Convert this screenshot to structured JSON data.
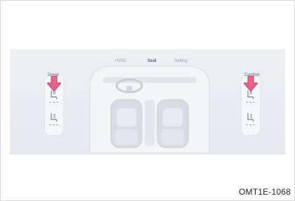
{
  "tabs": [
    {
      "label": "HVAC",
      "active": false
    },
    {
      "label": "Seat",
      "active": true
    },
    {
      "label": "Setting",
      "active": false
    }
  ],
  "left_panel": {
    "label": "Driver",
    "icons": [
      "seat-heat-icon",
      "seat-ventilation-icon"
    ]
  },
  "right_panel": {
    "label": "Comfort",
    "icons": [
      "seat-heat-icon",
      "seat-ventilation-icon"
    ]
  },
  "figure_code": "OMT1E-1068",
  "colors": {
    "accent": "#3a8fd6",
    "arrow": "#e8628a",
    "screen_bg": "#e9ecf1"
  }
}
